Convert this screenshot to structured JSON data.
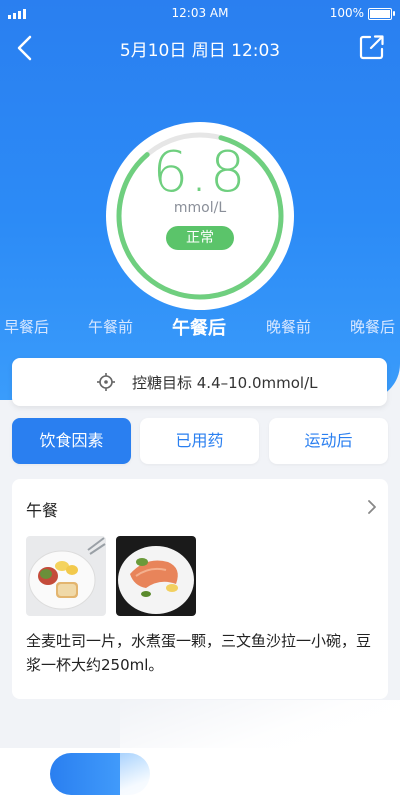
{
  "status_bar": {
    "time": "12:03 AM",
    "battery": "100%"
  },
  "nav": {
    "title": "5月10日 周日 12:03"
  },
  "reading": {
    "value": "6.8",
    "unit": "mmol/L",
    "status": "正常",
    "color": "#6fcf7f",
    "badge_color": "#5bc46a"
  },
  "tabs": [
    "早餐后",
    "午餐前",
    "午餐后",
    "晚餐前",
    "晚餐后"
  ],
  "active_tab": "午餐后",
  "target": {
    "text": "控糖目标 4.4–10.0mmol/L"
  },
  "chips": [
    "饮食因素",
    "已用药",
    "运动后"
  ],
  "active_chip": "饮食因素",
  "meal": {
    "title": "午餐",
    "photos": [
      "toast-egg-salad-plate",
      "salmon-salad-plate"
    ],
    "description": "全麦吐司一片，水煮蛋一颗，三文鱼沙拉一小碗，豆浆一杯大约250ml。"
  },
  "colors": {
    "primary": "#2a7ff0"
  }
}
